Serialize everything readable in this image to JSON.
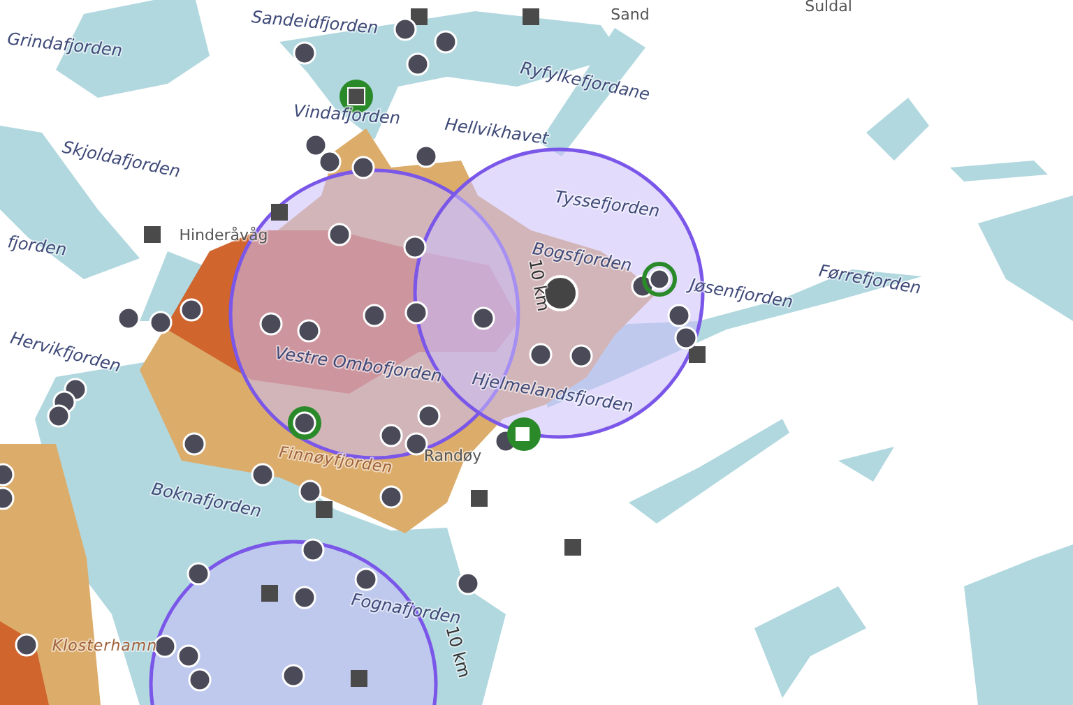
{
  "map": {
    "labels": [
      {
        "text": "Sandeidfjorden",
        "kind": "water"
      },
      {
        "text": "Grindafjorden",
        "kind": "water"
      },
      {
        "text": "Ryfylkefjordane",
        "kind": "water"
      },
      {
        "text": "Sand",
        "kind": "town"
      },
      {
        "text": "Suldal",
        "kind": "town"
      },
      {
        "text": "Vindafjorden",
        "kind": "water"
      },
      {
        "text": "Hellvikhavet",
        "kind": "water"
      },
      {
        "text": "Skjoldafjorden",
        "kind": "water"
      },
      {
        "text": "Tyssefjorden",
        "kind": "water"
      },
      {
        "text": "fjorden",
        "kind": "water"
      },
      {
        "text": "Hinderåvåg",
        "kind": "town"
      },
      {
        "text": "Bogsfjorden",
        "kind": "water"
      },
      {
        "text": "Førrefjorden",
        "kind": "water"
      },
      {
        "text": "Jøsenfjorden",
        "kind": "water"
      },
      {
        "text": "Hervikfjorden",
        "kind": "water"
      },
      {
        "text": "Vestre Ombofjorden",
        "kind": "water"
      },
      {
        "text": "Hjelmelandsfjorden",
        "kind": "water"
      },
      {
        "text": "Randøy",
        "kind": "town"
      },
      {
        "text": "Finnøyfjorden",
        "kind": "zone"
      },
      {
        "text": "Boknafjorden",
        "kind": "water"
      },
      {
        "text": "Fognafjorden",
        "kind": "water"
      },
      {
        "text": "Klosterhamn",
        "kind": "zone"
      }
    ],
    "range_labels": [
      "10 km",
      "10 km"
    ]
  }
}
